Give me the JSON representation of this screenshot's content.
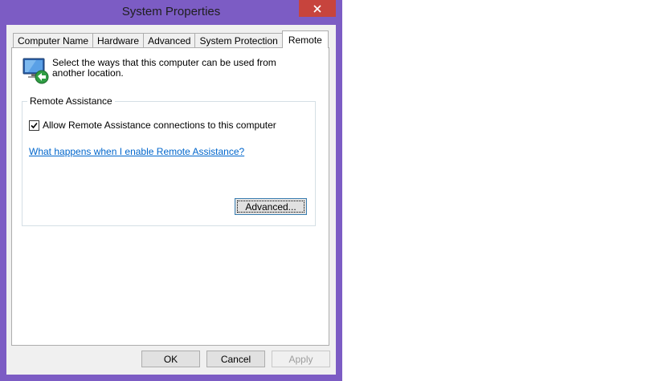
{
  "window": {
    "title": "System Properties",
    "close_label": "✕"
  },
  "tabs": [
    {
      "label": "Computer Name"
    },
    {
      "label": "Hardware"
    },
    {
      "label": "Advanced"
    },
    {
      "label": "System Protection"
    },
    {
      "label": "Remote",
      "active": true
    }
  ],
  "remote": {
    "intro_text": "Select the ways that this computer can be used from another location.",
    "group_label": "Remote Assistance",
    "allow_checkbox_label": "Allow Remote Assistance connections to this computer",
    "allow_checked": true,
    "help_link": "What happens when I enable Remote Assistance?",
    "advanced_button": "Advanced..."
  },
  "footer": {
    "ok_label": "OK",
    "cancel_label": "Cancel",
    "apply_label": "Apply"
  },
  "colors": {
    "frame": "#7c5cc4",
    "close": "#c7443d",
    "link": "#0066cc"
  }
}
